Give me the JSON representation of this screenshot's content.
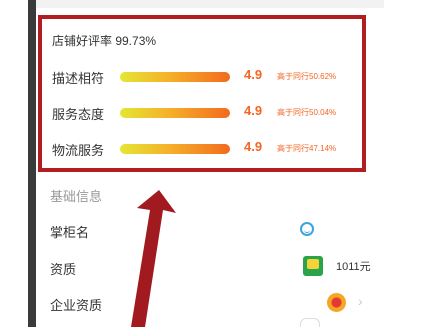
{
  "rating": {
    "shop_rate_text": "店铺好评率 99.73%",
    "rows": [
      {
        "label": "描述相符",
        "score": "4.9",
        "compare": "高于同行50.62%"
      },
      {
        "label": "服务态度",
        "score": "4.9",
        "compare": "高于同行50.04%"
      },
      {
        "label": "物流服务",
        "score": "4.9",
        "compare": "高于同行47.14%"
      }
    ]
  },
  "basic_info": {
    "title": "基础信息",
    "shopkeeper_label": "掌柜名",
    "qualification_label": "资质",
    "qualification_value": "1011元",
    "enterprise_label": "企业资质"
  },
  "colors": {
    "highlight_border": "#b01e22",
    "score_orange": "#f26522",
    "arrow_red": "#a11a1f"
  },
  "icons": {
    "shopkeeper": "wangwang-chat-icon",
    "qualification": "certificate-icon",
    "enterprise": "enterprise-badge-icon",
    "chevron": "chevron-right-icon"
  }
}
